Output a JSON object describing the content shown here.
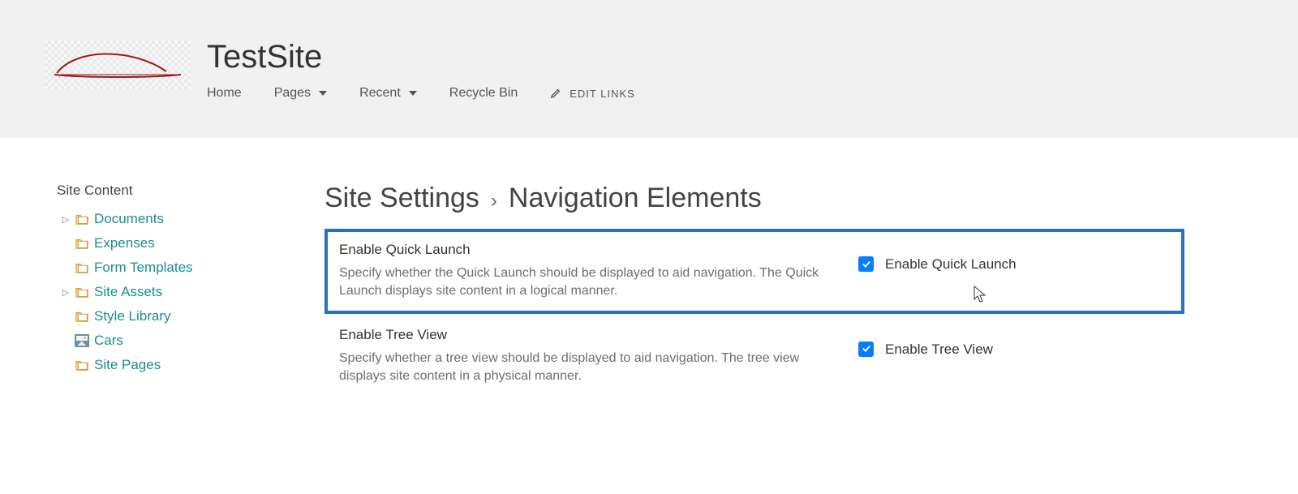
{
  "site": {
    "title": "TestSite"
  },
  "topnav": {
    "home": "Home",
    "pages": "Pages",
    "recent": "Recent",
    "recycle": "Recycle Bin",
    "edit_links": "EDIT LINKS"
  },
  "sidebar": {
    "header": "Site Content",
    "items": [
      {
        "label": "Documents",
        "expandable": true
      },
      {
        "label": "Expenses",
        "expandable": false
      },
      {
        "label": "Form Templates",
        "expandable": false
      },
      {
        "label": "Site Assets",
        "expandable": true
      },
      {
        "label": "Style Library",
        "expandable": false
      },
      {
        "label": "Cars",
        "expandable": false,
        "pic": true
      },
      {
        "label": "Site Pages",
        "expandable": false
      }
    ]
  },
  "breadcrumb": {
    "parent": "Site Settings",
    "current": "Navigation Elements"
  },
  "settings": {
    "quick_launch": {
      "title": "Enable Quick Launch",
      "desc": "Specify whether the Quick Launch should be displayed to aid navigation.  The Quick Launch displays site content in a logical manner.",
      "checkbox_label": "Enable Quick Launch",
      "checked": true,
      "highlighted": true
    },
    "tree_view": {
      "title": "Enable Tree View",
      "desc": "Specify whether a tree view should be displayed to aid navigation.  The tree view displays site content in a physical manner.",
      "checkbox_label": "Enable Tree View",
      "checked": true,
      "highlighted": false
    }
  }
}
